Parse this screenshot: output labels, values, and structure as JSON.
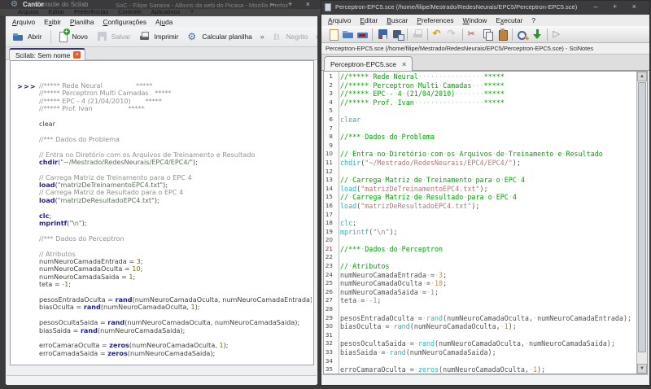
{
  "themes": {
    "left": {
      "comment": "#909090",
      "keyword": "#1f1f9e",
      "string": "#5a7258",
      "number": "#7d6608",
      "plain": "#3f3f3f",
      "prompt": "#16166b"
    },
    "right": {
      "comment": "#00a400",
      "keyword": "#30b3b3",
      "string": "#b07878",
      "number": "#bd8850",
      "plain": "#525252",
      "whitespace_dot": "#aecfae",
      "current_line_number": "#cc1111"
    }
  },
  "background_windows": {
    "cantor_title": "Cantor",
    "scilab_console_title": "Console do Scilab",
    "firefox_title": "SoC - Filipe Saraiva - Albuns da web do Picasa - Mozilla Firefox",
    "window_buttons": "–  +  ×",
    "console_menus": [
      "Arquivo",
      "Editar",
      "Preferências",
      "Controle",
      "Aplicativos",
      "?"
    ]
  },
  "left_window": {
    "menus": [
      {
        "label": "Arquivo",
        "u": 0
      },
      {
        "label": "Exibir",
        "u": 1
      },
      {
        "label": "Planilha",
        "u": 0
      },
      {
        "label": "Configurações",
        "u": 0
      },
      {
        "label": "Ajuda",
        "u": 2
      }
    ],
    "toolbar": [
      {
        "label": "Abrir",
        "icon": "open"
      },
      {
        "sep": true
      },
      {
        "label": "Novo",
        "icon": "new"
      },
      {
        "label": "Salvar",
        "icon": "save",
        "disabled": true
      },
      {
        "label": "Imprimir",
        "icon": "print"
      },
      {
        "label": "Calcular planilha",
        "icon": "calculate"
      },
      {
        "chev": "»"
      },
      {
        "label": "Negrito",
        "icon": "bold",
        "disabled": true
      },
      {
        "chev": "»"
      }
    ],
    "tab_label": "Scilab: Sem nome",
    "tab_close": "×",
    "prompt": ">>>",
    "status_text": ""
  },
  "right_window": {
    "title": "Perceptron-EPC5.sce (/home/filipe/Mestrado/RedesNeurais/EPC5/Perceptron-EPC5.sce)",
    "window_buttons": "–  +  ×",
    "menus": [
      {
        "label": "Arquivo",
        "u": 0
      },
      {
        "label": "Editar",
        "u": 0
      },
      {
        "label": "Buscar",
        "u": 0
      },
      {
        "label": "Preferences",
        "u": 0
      },
      {
        "label": "Window",
        "u": 0
      },
      {
        "label": "Executar",
        "u": 1
      },
      {
        "label": "?",
        "u": -1
      }
    ],
    "toolbar": [
      {
        "icon": "new-file"
      },
      {
        "icon": "open-file"
      },
      {
        "icon": "open-in-scilab"
      },
      {
        "sep": true
      },
      {
        "icon": "save"
      },
      {
        "icon": "save-as"
      },
      {
        "sep": true
      },
      {
        "icon": "print",
        "disabled": true
      },
      {
        "sep": true
      },
      {
        "icon": "undo"
      },
      {
        "icon": "redo",
        "disabled": true
      },
      {
        "sep": true
      },
      {
        "icon": "cut"
      },
      {
        "icon": "copy"
      },
      {
        "icon": "paste"
      },
      {
        "sep": true
      },
      {
        "icon": "find-replace"
      },
      {
        "icon": "load-into-scilab"
      },
      {
        "sep": true
      },
      {
        "icon": "execute"
      }
    ],
    "path_bar": "Perceptron-EPC5.sce (/home/filipe/Mestrado/RedesNeurais/EPC5/Perceptron-EPC5.sce) - SciNotes",
    "tab_label": "Perceptron-EPC5.sce",
    "tab_close": "×",
    "current_line_number": 21,
    "status_text": ""
  },
  "code": {
    "lines": [
      [
        [
          "cm",
          "//***** Rede Neural                *****"
        ]
      ],
      [
        [
          "cm",
          "//***** Perceptron Multi Camadas   *****"
        ]
      ],
      [
        [
          "cm",
          "//***** EPC - 4 (21/04/2010)       *****"
        ]
      ],
      [
        [
          "cm",
          "//***** Prof. Ivan                 *****"
        ]
      ],
      [],
      [
        [
          "kw2",
          "clear"
        ]
      ],
      [],
      [
        [
          "cm",
          "//*** Dados do Problema"
        ]
      ],
      [],
      [
        [
          "cm",
          "// Entra no Diretório com os Arquivos de Treinamento e Resultado"
        ]
      ],
      [
        [
          "kw",
          "chdir"
        ],
        [
          "pl",
          "("
        ],
        [
          "str",
          "\"~/Mestrado/RedesNeurais/EPC4/EPC4/\""
        ],
        [
          "pl",
          ");"
        ]
      ],
      [],
      [
        [
          "cm",
          "// Carrega Matriz de Treinamento para o EPC 4"
        ]
      ],
      [
        [
          "kw",
          "load"
        ],
        [
          "pl",
          "("
        ],
        [
          "str",
          "\"matrizDeTreinamentoEPC4.txt\""
        ],
        [
          "pl",
          ");"
        ]
      ],
      [
        [
          "cm",
          "// Carrega Matriz de Resultado para o EPC 4"
        ]
      ],
      [
        [
          "kw",
          "load"
        ],
        [
          "pl",
          "("
        ],
        [
          "str",
          "\"matrizDeResultadoEPC4.txt\""
        ],
        [
          "pl",
          ");"
        ]
      ],
      [],
      [
        [
          "kw",
          "clc"
        ],
        [
          "pl",
          ";"
        ]
      ],
      [
        [
          "kw",
          "mprintf"
        ],
        [
          "pl",
          "("
        ],
        [
          "str",
          "\"\\n\""
        ],
        [
          "pl",
          ");"
        ]
      ],
      [],
      [
        [
          "cm",
          "//*** Dados do Perceptron"
        ]
      ],
      [],
      [
        [
          "cm",
          "// Atributos"
        ]
      ],
      [
        [
          "pl",
          "numNeuroCamadaEntrada = "
        ],
        [
          "num",
          "3"
        ],
        [
          "pl",
          ";"
        ]
      ],
      [
        [
          "pl",
          "numNeuroCamadaOculta = "
        ],
        [
          "num",
          "10"
        ],
        [
          "pl",
          ";"
        ]
      ],
      [
        [
          "pl",
          "numNeuroCamadaSaida = "
        ],
        [
          "num",
          "1"
        ],
        [
          "pl",
          ";"
        ]
      ],
      [
        [
          "pl",
          "teta = "
        ],
        [
          "num",
          "-1"
        ],
        [
          "pl",
          ";"
        ]
      ],
      [],
      [
        [
          "pl",
          "pesosEntradaOculta = "
        ],
        [
          "kw",
          "rand"
        ],
        [
          "pl",
          "(numNeuroCamadaOculta, numNeuroCamadaEntrada);"
        ]
      ],
      [
        [
          "pl",
          "biasOculta = "
        ],
        [
          "kw",
          "rand"
        ],
        [
          "pl",
          "(numNeuroCamadaOculta, "
        ],
        [
          "num",
          "1"
        ],
        [
          "pl",
          ");"
        ]
      ],
      [],
      [
        [
          "pl",
          "pesosOcultaSaida = "
        ],
        [
          "kw",
          "rand"
        ],
        [
          "pl",
          "(numNeuroCamadaOculta, numNeuroCamadaSaida);"
        ]
      ],
      [
        [
          "pl",
          "biasSaida = "
        ],
        [
          "kw",
          "rand"
        ],
        [
          "pl",
          "(numNeuroCamadaSaida);"
        ]
      ],
      [],
      [
        [
          "pl",
          "erroCamaraOculta = "
        ],
        [
          "kw",
          "zeros"
        ],
        [
          "pl",
          "(numNeuroCamadaOculta, "
        ],
        [
          "num",
          "1"
        ],
        [
          "pl",
          ");"
        ]
      ],
      [
        [
          "pl",
          "erroCamadaSaida = "
        ],
        [
          "kw",
          "zeros"
        ],
        [
          "pl",
          "(numNeuroCamadaSaida);"
        ]
      ]
    ]
  }
}
